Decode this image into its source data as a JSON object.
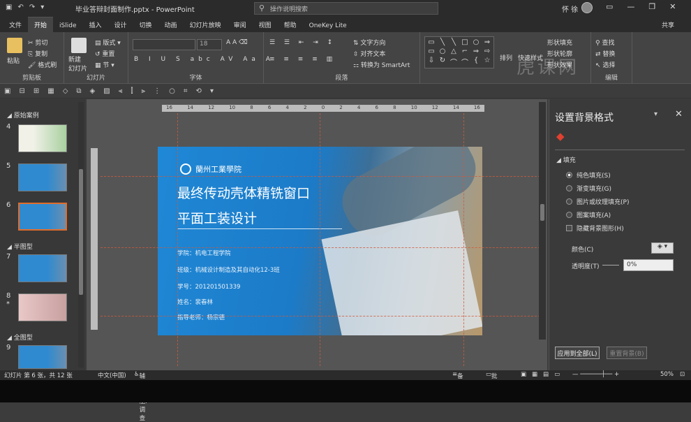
{
  "titlebar": {
    "doc_title": "毕业答辩封面制作.pptx  -  PowerPoint",
    "search_placeholder": "操作说明搜索",
    "user": "怀 徐"
  },
  "tabs": [
    "文件",
    "开始",
    "iSlide",
    "插入",
    "设计",
    "切换",
    "动画",
    "幻灯片放映",
    "审阅",
    "视图",
    "帮助",
    "OneKey Lite"
  ],
  "active_tab": "开始",
  "share_label": "共享",
  "watermark": "虎课网",
  "ribbon": {
    "clipboard": {
      "label": "剪贴板",
      "paste": "粘贴",
      "cut": "剪切",
      "copy": "复制",
      "format_painter": "格式刷"
    },
    "slides": {
      "label": "幻灯片",
      "new_slide": "新建\n幻灯片",
      "layout": "版式",
      "reset": "重置",
      "section": "节"
    },
    "font": {
      "label": "字体",
      "size": "18"
    },
    "paragraph": {
      "label": "段落",
      "text_direction": "文字方向",
      "align_text": "对齐文本",
      "smartart": "转换为 SmartArt"
    },
    "drawing": {
      "arrange": "排列",
      "quick_styles": "快速样式",
      "shape_fill": "形状填充",
      "shape_outline": "形状轮廓",
      "shape_effects": "形状效果"
    },
    "editing": {
      "label": "编辑",
      "find": "查找",
      "replace": "替换",
      "select": "选择"
    }
  },
  "slide_panel": {
    "sections": [
      {
        "name": "原始案例"
      },
      {
        "name": "半图型"
      },
      {
        "name": "全图型"
      }
    ],
    "thumbs": [
      {
        "num": "4"
      },
      {
        "num": "5"
      },
      {
        "num": "6"
      },
      {
        "num": "7"
      },
      {
        "num": "8",
        "mark": "*"
      },
      {
        "num": "9"
      }
    ]
  },
  "ruler": {
    "ticks": [
      "16",
      "14",
      "12",
      "10",
      "8",
      "6",
      "4",
      "2",
      "0",
      "2",
      "4",
      "6",
      "8",
      "10",
      "12",
      "14",
      "16"
    ]
  },
  "slide": {
    "school": "蘭州工業學院",
    "title_line1": "最终传动壳体精铣窗口",
    "title_line2": "平面工装设计",
    "info": [
      "学院：机电工程学院",
      "班级：机械设计制造及其自动化12-3班",
      "学号：201201501339",
      "姓名：裴春林",
      "指导老师：杨宗德"
    ]
  },
  "format_pane": {
    "title": "设置背景格式",
    "section": "填充",
    "options": [
      {
        "label": "纯色填充(S)",
        "selected": true
      },
      {
        "label": "渐变填充(G)",
        "selected": false
      },
      {
        "label": "图片或纹理填充(P)",
        "selected": false
      },
      {
        "label": "图案填充(A)",
        "selected": false
      }
    ],
    "hide_graphics": "隐藏背景图形(H)",
    "color_label": "颜色(C)",
    "transparency_label": "透明度(T)",
    "transparency_value": "0%",
    "apply_all": "应用到全部(L)",
    "reset_bg": "重置背景(B)"
  },
  "status": {
    "slide_info": "幻灯片 第 6 张，共 12 张",
    "language": "中文(中国)",
    "accessibility": "辅助功能: 调查",
    "notes": "备注",
    "comments": "批注",
    "zoom": "50%"
  }
}
